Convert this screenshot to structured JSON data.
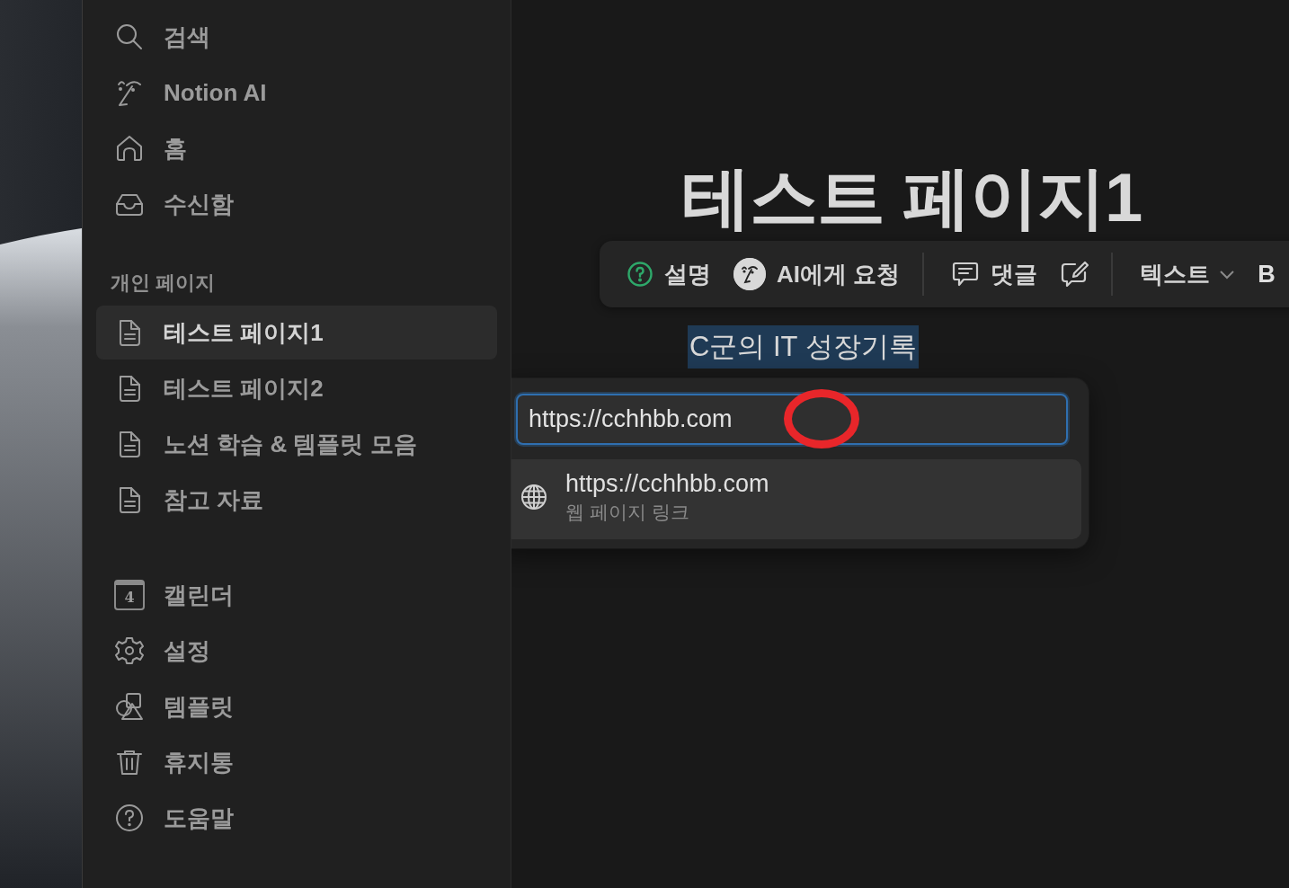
{
  "sidebar": {
    "top_items": [
      {
        "label": "검색",
        "selected": false
      },
      {
        "label": "Notion AI",
        "selected": false
      },
      {
        "label": "홈",
        "selected": false
      },
      {
        "label": "수신함",
        "selected": false
      }
    ],
    "section_title": "개인 페이지",
    "pages": [
      {
        "label": "테스트 페이지1",
        "selected": true
      },
      {
        "label": "테스트 페이지2",
        "selected": false
      },
      {
        "label": "노션 학습 & 템플릿 모음",
        "selected": false
      },
      {
        "label": "참고 자료",
        "selected": false
      }
    ],
    "bottom_items": [
      {
        "label": "캘린더",
        "selected": false,
        "badge": "4"
      },
      {
        "label": "설정",
        "selected": false
      },
      {
        "label": "템플릿",
        "selected": false
      },
      {
        "label": "휴지통",
        "selected": false
      },
      {
        "label": "도움말",
        "selected": false
      }
    ]
  },
  "page": {
    "title": "테스트 페이지1",
    "selected_text": "C군의 IT 성장기록"
  },
  "toolbar": [
    {
      "kind": "button",
      "label": "설명"
    },
    {
      "kind": "button",
      "label": "AI에게 요청"
    },
    {
      "kind": "divider"
    },
    {
      "kind": "button",
      "label": "댓글"
    },
    {
      "kind": "icon"
    },
    {
      "kind": "divider"
    },
    {
      "kind": "dropdown",
      "label": "텍스트"
    },
    {
      "kind": "bold",
      "label": "B"
    }
  ],
  "link_popup": {
    "value": "https://cchhbb.com",
    "suggestions": [
      {
        "title": "https://cchhbb.com",
        "subtitle": "웹 페이지 링크",
        "selected": true
      }
    ]
  },
  "annotation_circle": true
}
